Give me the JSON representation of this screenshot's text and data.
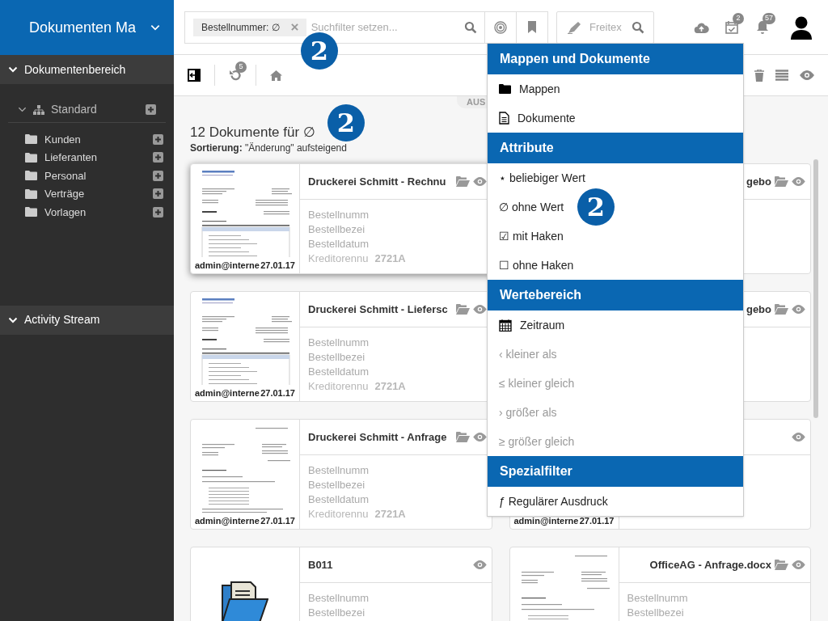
{
  "sidebar": {
    "app_title": "Dokumenten Ma",
    "sections": [
      {
        "label": "Dokumentenbereich",
        "expanded": true
      },
      {
        "label": "Activity Stream",
        "expanded": true
      }
    ],
    "tree": {
      "label": "Standard",
      "expanded": true,
      "children": [
        {
          "label": "Kunden"
        },
        {
          "label": "Lieferanten"
        },
        {
          "label": "Personal"
        },
        {
          "label": "Verträge"
        },
        {
          "label": "Vorlagen"
        }
      ]
    }
  },
  "topbar": {
    "filter_chip": "Bestellnummer: ∅",
    "search_placeholder": "Suchfilter setzen...",
    "freetext_placeholder": "Freitex",
    "tasks_count": "2",
    "notifications_count": "57"
  },
  "toolbar": {
    "undo_count": "5"
  },
  "results": {
    "tab": "AUS",
    "heading": "12 Dokumente für ∅",
    "sorting": "**Sortierung:** \"Änderung\" aufsteigend"
  },
  "cards": [
    {
      "title": "Druckerei Schmitt - Rechnu",
      "in_folder": true,
      "selected": true,
      "kind": "document",
      "user": "admin@interne",
      "date": "27.01.17",
      "fields": [
        "Bestellnumm",
        "Bestellbezei",
        "Bestelldatum"
      ],
      "extra_field": "Kreditorennu",
      "extra_value": "2721A"
    },
    {
      "title": "gebo",
      "in_folder": true,
      "selected": false
    },
    {
      "title": "Druckerei Schmitt - Liefersc",
      "in_folder": true,
      "selected": false,
      "kind": "document",
      "user": "admin@interne",
      "date": "27.01.17",
      "fields": [
        "Bestellnumm",
        "Bestellbezei",
        "Bestelldatum"
      ],
      "extra_field": "Kreditorennu",
      "extra_value": "2721A"
    },
    {
      "title": "gebo",
      "in_folder": true,
      "selected": false
    },
    {
      "title": "Druckerei Schmitt - Anfrage",
      "in_folder": true,
      "selected": false,
      "kind": "letter",
      "user": "admin@interne",
      "date": "27.01.17",
      "fields": [
        "Bestellnumm",
        "Bestellbezei",
        "Bestelldatum"
      ],
      "extra_field": "Kreditorennu",
      "extra_value": "2721A"
    },
    {
      "in_folder": false,
      "selected": false,
      "user": "admin@interne",
      "date": "27.01.17"
    },
    {
      "title": "B011",
      "in_folder": false,
      "selected": false,
      "kind": "folder",
      "fields": [
        "Bestellnumm",
        "Bestellbezei"
      ]
    },
    {
      "title": "OfficeAG - Anfrage.docx",
      "in_folder": true,
      "selected": false,
      "kind": "letter",
      "fields": [
        "Bestellnumm",
        "Bestellbezei"
      ]
    }
  ],
  "menu": {
    "groups": [
      {
        "title": "Mappen und Dokumente",
        "items": [
          {
            "kind": "collection",
            "label": "Mappen",
            "disabled": false
          },
          {
            "kind": "document",
            "label": "Dokumente",
            "disabled": false
          }
        ]
      },
      {
        "title": "Attribute",
        "items": [
          {
            "kind": "text",
            "label": "⋆ beliebiger Wert",
            "disabled": false
          },
          {
            "kind": "text",
            "label": "∅ ohne Wert",
            "disabled": false
          },
          {
            "kind": "text",
            "label": "☑ mit Haken",
            "disabled": false
          },
          {
            "kind": "text",
            "label": "☐ ohne Haken",
            "disabled": false
          }
        ]
      },
      {
        "title": "Wertebereich",
        "items": [
          {
            "kind": "date",
            "label": "Zeitraum",
            "disabled": false
          },
          {
            "kind": "text",
            "label": "‹ kleiner als",
            "disabled": true
          },
          {
            "kind": "text",
            "label": "≤ kleiner gleich",
            "disabled": true
          },
          {
            "kind": "text",
            "label": "› größer als",
            "disabled": true
          },
          {
            "kind": "text",
            "label": "≥ größer gleich",
            "disabled": true
          }
        ]
      },
      {
        "title": "Spezialfilter",
        "items": [
          {
            "kind": "text",
            "label": "ƒ Regulärer Ausdruck",
            "disabled": false
          }
        ]
      }
    ]
  },
  "callouts": [
    "2",
    "2",
    "2"
  ]
}
